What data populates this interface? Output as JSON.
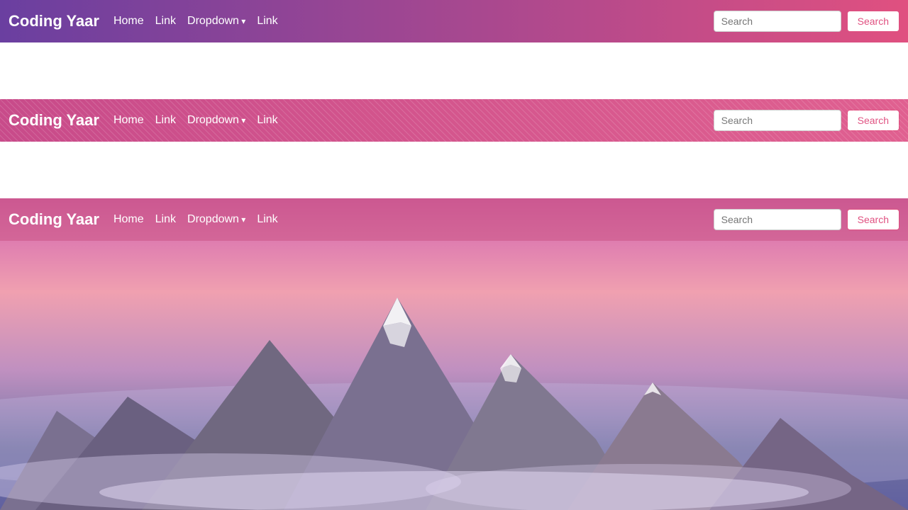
{
  "brand": {
    "name": "Coding Yaar"
  },
  "nav": {
    "home": "Home",
    "link1": "Link",
    "dropdown": "Dropdown",
    "link2": "Link"
  },
  "search": {
    "placeholder": "Search",
    "button_label": "Search"
  },
  "navbar1": {
    "gradient_start": "#6a3fa0",
    "gradient_end": "#e05080"
  },
  "navbar2": {
    "gradient_start": "#c84b8a",
    "gradient_end": "#e06090"
  },
  "navbar3": {
    "gradient_start": "#d060a0",
    "gradient_end": "#e080b0"
  }
}
